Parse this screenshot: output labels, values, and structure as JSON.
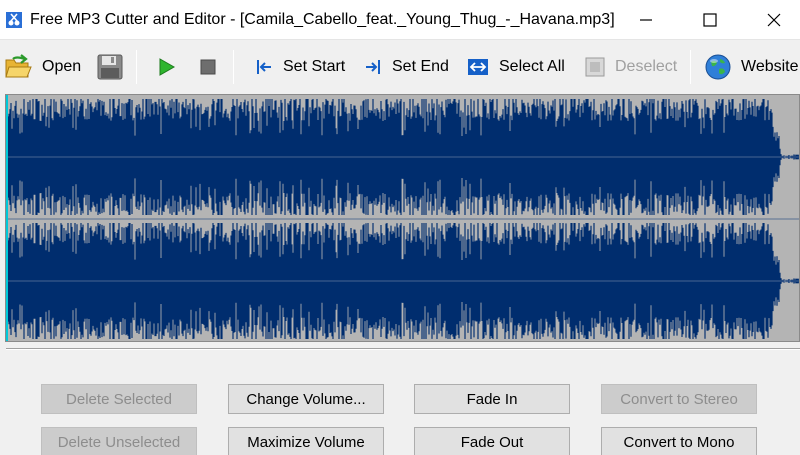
{
  "window": {
    "title": "Free MP3 Cutter and Editor - [Camila_Cabello_feat._Young_Thug_-_Havana.mp3]",
    "app_icon": "scissors-note-icon",
    "controls": [
      "minimize-icon",
      "maximize-icon",
      "close-icon"
    ]
  },
  "toolbar": {
    "open_label": "Open",
    "open_icon": "open-folder-icon",
    "save_icon": "save-disk-icon",
    "play_icon": "play-icon",
    "stop_icon": "stop-icon",
    "set_start_label": "Set Start",
    "set_start_icon": "set-start-icon",
    "set_end_label": "Set End",
    "set_end_icon": "set-end-icon",
    "select_all_label": "Select All",
    "select_all_icon": "select-all-icon",
    "deselect_label": "Deselect",
    "deselect_icon": "deselect-icon",
    "website_label": "Website",
    "website_icon": "globe-icon"
  },
  "waveform": {
    "background_color": "#b4b4b4",
    "wave_color": "#002d6e",
    "channels": 2,
    "selection": "none"
  },
  "actions": {
    "delete_selected": "Delete Selected",
    "change_volume": "Change Volume...",
    "fade_in": "Fade In",
    "convert_to_stereo": "Convert to Stereo",
    "delete_unselected": "Delete Unselected",
    "maximize_volume": "Maximize Volume",
    "fade_out": "Fade Out",
    "convert_to_mono": "Convert to Mono"
  }
}
